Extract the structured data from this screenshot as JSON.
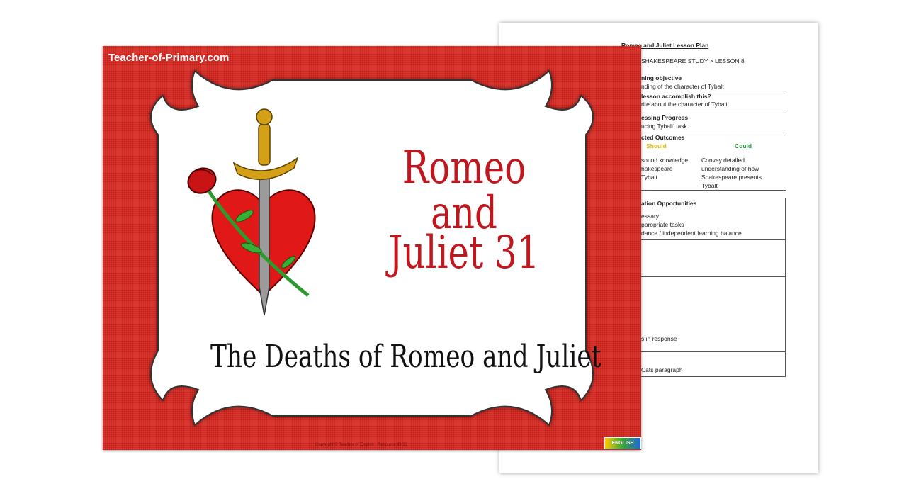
{
  "doc": {
    "title": "Romeo and Juliet Lesson Plan",
    "breadcrumb": "SHAKESPEARE STUDY > LESSON 8",
    "learning_objective_heading": "ning objective",
    "learning_objective_text": "nding of the character of Tybalt",
    "accomplish_heading": "lesson accomplish this?",
    "accomplish_text": "rite about the character of Tybalt",
    "progress_heading": "essing Progress",
    "progress_text": "ucing Tybalt' task",
    "outcomes_heading": "cted Outcomes",
    "should_label": "Should",
    "could_label": "Could",
    "should_lines": [
      "sound knowledge",
      "hakespeare",
      "Tybalt"
    ],
    "could_lines": [
      "Convey detailed",
      "understanding of how",
      "Shakespeare presents",
      "Tybalt"
    ],
    "differentiation_heading": "ation Opportunities",
    "differentiation_lines": [
      "essary",
      "ppropriate tasks",
      "dance / independent learning balance"
    ],
    "response_text": "s in response",
    "cats_text": "Cats paragraph",
    "colors": {
      "should": "#e6b800",
      "could": "#22a03a"
    }
  },
  "slide": {
    "site_label": "Teacher-of-Primary.com",
    "title_line1": "Romeo and",
    "title_line2": "Juliet 31",
    "subtitle": "The Deaths of Romeo and Juliet",
    "copyright": "Copyright © Teacher of English · Resource ID 31",
    "logo_text": "ENGLISH",
    "colors": {
      "background": "#d8231c",
      "title": "#c0161d",
      "heart": "#e01818",
      "dagger_hilt": "#d4a017"
    }
  }
}
